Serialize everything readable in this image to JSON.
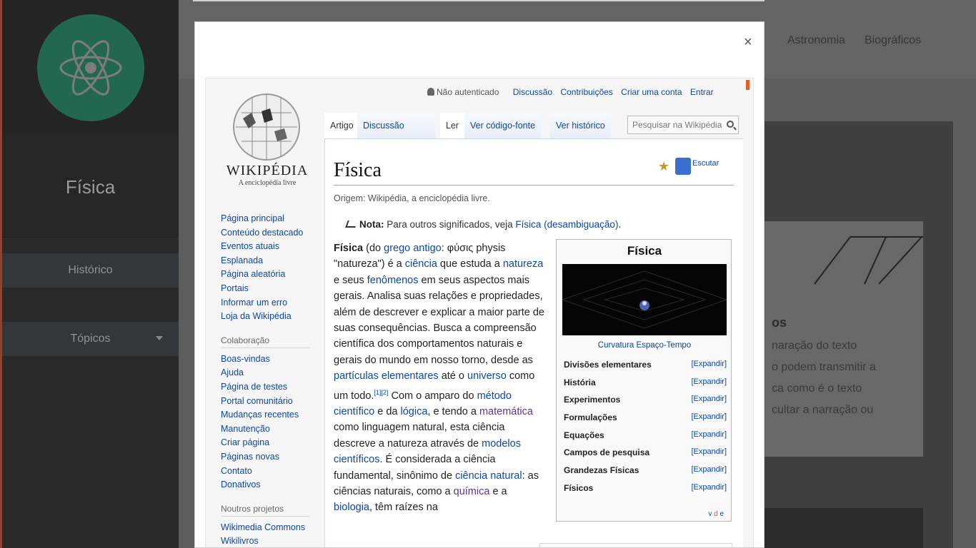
{
  "app": {
    "title": "Física",
    "sidebar_items": [
      {
        "label": "Histórico"
      },
      {
        "label": "Tópicos"
      }
    ],
    "topnav": [
      "Astronomia",
      "Biográficos"
    ],
    "card_heading": "os",
    "card_lines": [
      "naração do texto",
      "o podem transmitir a",
      "ca como é o texto",
      "cultar a narração ou"
    ]
  },
  "modal": {
    "close_label": "×"
  },
  "wiki": {
    "wordmark": "WIKIPÉDIA",
    "tagline": "A enciclopédia livre",
    "nav_links": [
      "Página principal",
      "Conteúdo destacado",
      "Eventos atuais",
      "Esplanada",
      "Página aleatória",
      "Portais",
      "Informar um erro",
      "Loja da Wikipédia"
    ],
    "collab_heading": "Colaboração",
    "collab_links": [
      "Boas-vindas",
      "Ajuda",
      "Página de testes",
      "Portal comunitário",
      "Mudanças recentes",
      "Manutenção",
      "Criar página",
      "Páginas novas",
      "Contato",
      "Donativos"
    ],
    "projects_heading": "Noutros projetos",
    "project_links": [
      "Wikimedia Commons",
      "Wikilivros"
    ],
    "personal": {
      "not_logged": "Não autenticado",
      "discussion": "Discussão",
      "contributions": "Contribuições",
      "create_account": "Criar uma conta",
      "login": "Entrar"
    },
    "tabs": {
      "article": "Artigo",
      "discussion": "Discussão",
      "read": "Ler",
      "source": "Ver código-fonte",
      "history": "Ver histórico"
    },
    "search_placeholder": "Pesquisar na Wikipédia",
    "title": "Física",
    "listen": "Escutar",
    "origin": "Origem: Wikipédia, a enciclopédia livre.",
    "note_label": "Nota:",
    "note_text": "Para outros significados, veja",
    "note_link": "Física (desambiguação)",
    "note_end": ".",
    "body": {
      "p1_term": "Física",
      "p1_a": " (do ",
      "p1_l1": "grego antigo",
      "p1_b": ": φύσις physis \"natureza\") é a ",
      "p1_l2": "ciência",
      "p1_c": " que estuda a ",
      "p1_l3": "natureza",
      "p1_d": " e seus ",
      "p1_l4": "fenômenos",
      "p1_e": " em seus aspectos mais gerais. Analisa suas relações e propriedades, além de descrever e explicar a maior parte de suas consequências. Busca a compreensão científica dos comportamentos naturais e gerais do mundo em nosso torno, desde as ",
      "p1_l5": "partículas elementares",
      "p1_f": " até o ",
      "p1_l6": "universo",
      "p1_g": " como um todo.",
      "p1_ref": "[1][2]",
      "p1_h": " Com o amparo do ",
      "p1_l7": "método científico",
      "p1_i": " e da ",
      "p1_l8": "lógica",
      "p1_j": ", e tendo a ",
      "p1_l9": "matemática",
      "p1_k": " como linguagem natural, esta ciência descreve a natureza através de ",
      "p1_l10": "modelos científicos",
      "p1_l": ". É considerada a ciência fundamental, sinônimo de ",
      "p1_l11": "ciência natural",
      "p1_m": ": as ciências naturais, como a ",
      "p1_l12": "química",
      "p1_n": " e a ",
      "p1_l13": "biologia",
      "p1_o": ", têm raízes na"
    },
    "infobox": {
      "title": "Física",
      "caption": "Curvatura Espaço-Tempo",
      "rows": [
        {
          "label": "Divisões elementares",
          "value": "[Expandir]"
        },
        {
          "label": "História",
          "value": "[Expandir]"
        },
        {
          "label": "Experimentos",
          "value": "[Expandir]"
        },
        {
          "label": "Formulações",
          "value": "[Expandir]"
        },
        {
          "label": "Equações",
          "value": "[Expandir]"
        },
        {
          "label": "Campos de pesquisa",
          "value": "[Expandir]"
        },
        {
          "label": "Grandezas Físicas",
          "value": "[Expandir]"
        },
        {
          "label": "Físicos",
          "value": "[Expandir]"
        }
      ],
      "nav": [
        "v",
        "d",
        "e"
      ]
    }
  },
  "colors": {
    "accent_green": "#1f8a68",
    "link_blue": "#0b47a8",
    "sidebar_dark": "#2a2a2a"
  }
}
